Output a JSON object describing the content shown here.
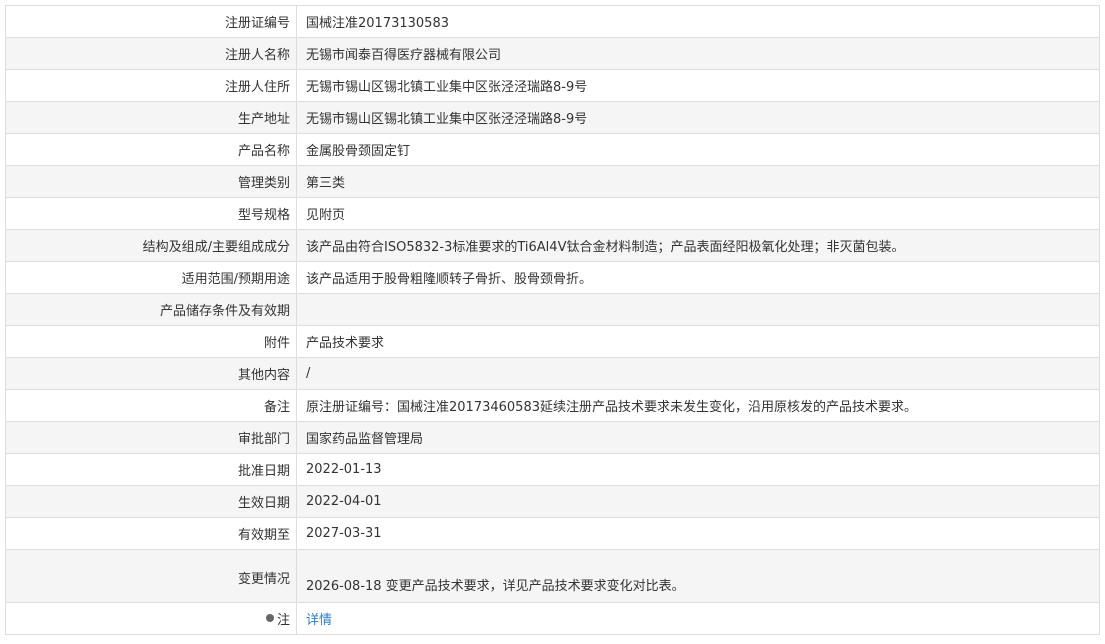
{
  "rows": [
    {
      "label": "注册证编号",
      "value": "国械注准20173130583"
    },
    {
      "label": "注册人名称",
      "value": "无锡市闻泰百得医疗器械有限公司"
    },
    {
      "label": "注册人住所",
      "value": "无锡市锡山区锡北镇工业集中区张泾泾瑞路8-9号"
    },
    {
      "label": "生产地址",
      "value": "无锡市锡山区锡北镇工业集中区张泾泾瑞路8-9号"
    },
    {
      "label": "产品名称",
      "value": "金属股骨颈固定钉"
    },
    {
      "label": "管理类别",
      "value": "第三类"
    },
    {
      "label": "型号规格",
      "value": "见附页"
    },
    {
      "label": "结构及组成/主要组成成分",
      "value": "该产品由符合ISO5832-3标准要求的Ti6Al4V钛合金材料制造；产品表面经阳极氧化处理；非灭菌包装。"
    },
    {
      "label": "适用范围/预期用途",
      "value": "该产品适用于股骨粗隆顺转子骨折、股骨颈骨折。"
    },
    {
      "label": "产品储存条件及有效期",
      "value": ""
    },
    {
      "label": "附件",
      "value": "产品技术要求"
    },
    {
      "label": "其他内容",
      "value": "/"
    },
    {
      "label": "备注",
      "value": "原注册证编号：国械注准20173460583延续注册产品技术要求未发生变化，沿用原核发的产品技术要求。"
    },
    {
      "label": "审批部门",
      "value": "国家药品监督管理局"
    },
    {
      "label": "批准日期",
      "value": "2022-01-13"
    },
    {
      "label": "生效日期",
      "value": "2022-04-01"
    },
    {
      "label": "有效期至",
      "value": "2027-03-31"
    },
    {
      "label": "变更情况",
      "value": "2026-08-18 变更产品技术要求，详见产品技术要求变化对比表。"
    }
  ],
  "note": {
    "label": "注",
    "link_text": "详情",
    "icon": "pin-icon"
  },
  "colors": {
    "border": "#dddddd",
    "alt_row": "#f5f5f5",
    "link": "#2f7dbd",
    "text": "#333333"
  }
}
